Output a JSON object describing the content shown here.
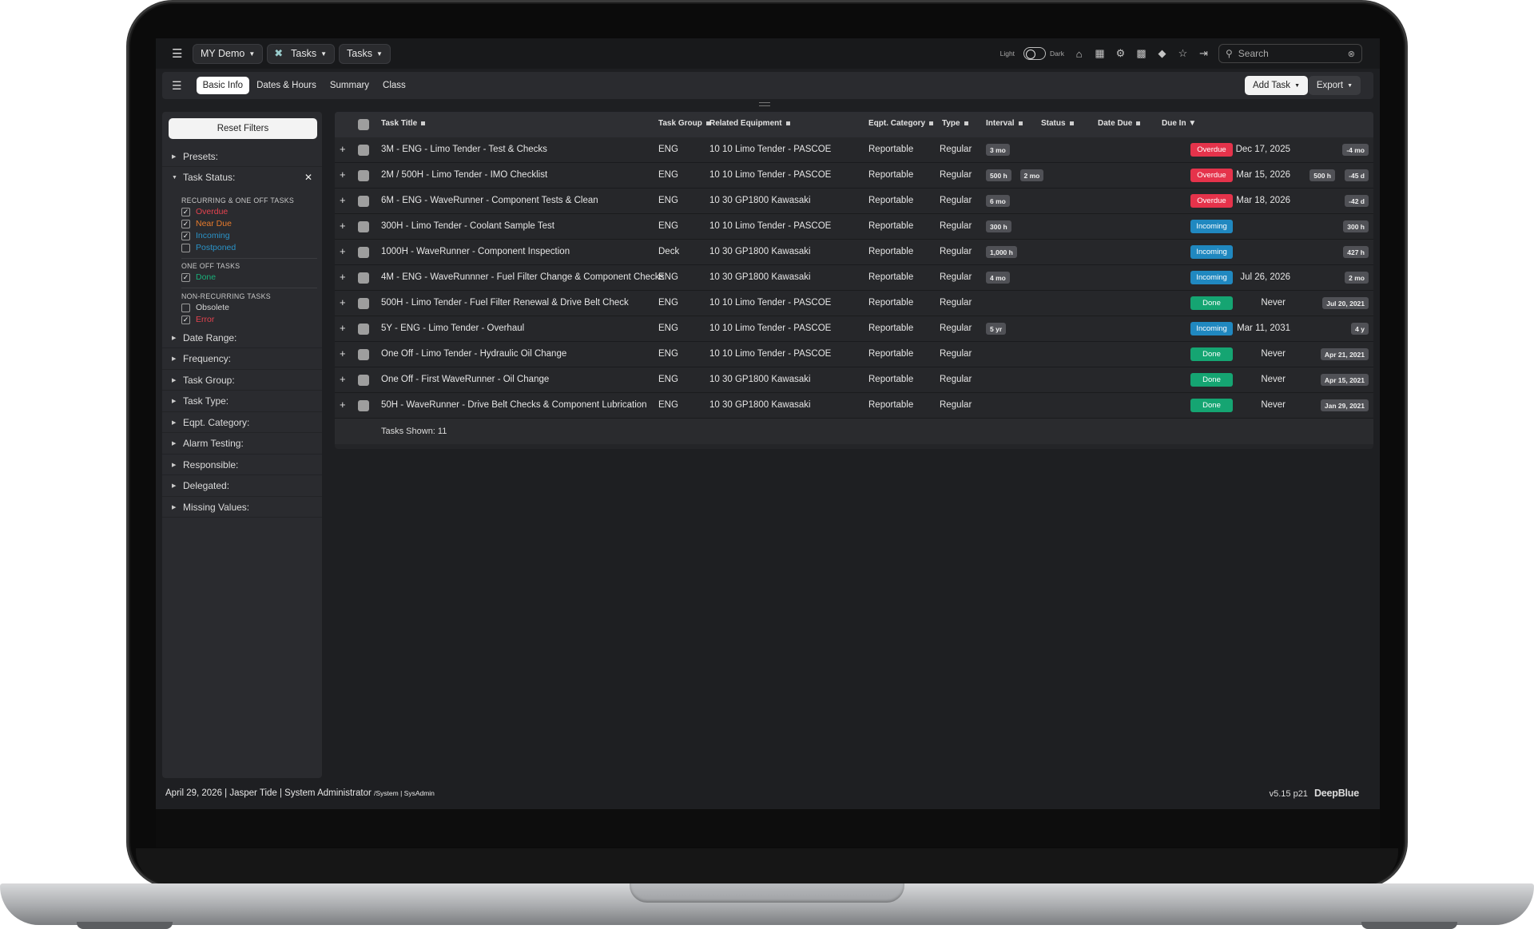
{
  "topbar": {
    "workspace": "MY Demo",
    "module": "Tasks",
    "view": "Tasks",
    "theme_light": "Light",
    "theme_dark": "Dark",
    "search_placeholder": "Search"
  },
  "navbar": {
    "tabs": [
      {
        "label": "Basic Info",
        "active": true
      },
      {
        "label": "Dates & Hours",
        "active": false
      },
      {
        "label": "Summary",
        "active": false
      },
      {
        "label": "Class",
        "active": false
      }
    ],
    "add_task": "Add Task",
    "export": "Export"
  },
  "sidebar": {
    "reset": "Reset Filters",
    "presets": "Presets:",
    "task_status": "Task Status:",
    "group1": "RECURRING & ONE OFF TASKS",
    "group1_items": [
      {
        "label": "Overdue",
        "checked": true,
        "color": "#e5434f"
      },
      {
        "label": "Near Due",
        "checked": true,
        "color": "#e87b2c"
      },
      {
        "label": "Incoming",
        "checked": true,
        "color": "#2a93c8"
      },
      {
        "label": "Postponed",
        "checked": false,
        "color": "#2a93c8"
      }
    ],
    "group2": "ONE OFF TASKS",
    "group2_items": [
      {
        "label": "Done",
        "checked": true,
        "color": "#19b07a"
      }
    ],
    "group3": "NON-RECURRING TASKS",
    "group3_items": [
      {
        "label": "Obsolete",
        "checked": false,
        "color": "#d4d4d4"
      },
      {
        "label": "Error",
        "checked": true,
        "color": "#e5434f"
      }
    ],
    "filters": [
      "Date Range:",
      "Frequency:",
      "Task Group:",
      "Task Type:",
      "Eqpt. Category:",
      "Alarm Testing:",
      "Responsible:",
      "Delegated:",
      "Missing Values:"
    ]
  },
  "table": {
    "headers": {
      "title": "Task Title",
      "group": "Task Group",
      "equipment": "Related Equipment",
      "category": "Eqpt. Category",
      "type": "Type",
      "interval": "Interval",
      "status": "Status",
      "date_due": "Date Due",
      "due_in": "Due In ▼"
    },
    "rows": [
      {
        "title": "3M - ENG - Limo Tender - Test & Checks",
        "group": "ENG",
        "equipment": "10 10 Limo Tender - PASCOE",
        "category": "Reportable",
        "type": "Regular",
        "interval": [
          "3 mo"
        ],
        "status": "Overdue",
        "date_due": "Dec 17, 2025",
        "due_in": [
          "-4 mo"
        ]
      },
      {
        "title": "2M / 500H - Limo Tender - IMO Checklist",
        "group": "ENG",
        "equipment": "10 10 Limo Tender - PASCOE",
        "category": "Reportable",
        "type": "Regular",
        "interval": [
          "500 h",
          "2 mo"
        ],
        "status": "Overdue",
        "date_due": "Mar 15, 2026",
        "due_in": [
          "500 h",
          "-45 d"
        ]
      },
      {
        "title": "6M - ENG - WaveRunner - Component Tests & Clean",
        "group": "ENG",
        "equipment": "10 30 GP1800 Kawasaki",
        "category": "Reportable",
        "type": "Regular",
        "interval": [
          "6 mo"
        ],
        "status": "Overdue",
        "date_due": "Mar 18, 2026",
        "due_in": [
          "-42 d"
        ]
      },
      {
        "title": "300H - Limo Tender - Coolant Sample Test",
        "group": "ENG",
        "equipment": "10 10 Limo Tender - PASCOE",
        "category": "Reportable",
        "type": "Regular",
        "interval": [
          "300 h"
        ],
        "status": "Incoming",
        "date_due": "",
        "due_in": [
          "300 h"
        ]
      },
      {
        "title": "1000H - WaveRunner - Component Inspection",
        "group": "Deck",
        "equipment": "10 30 GP1800 Kawasaki",
        "category": "Reportable",
        "type": "Regular",
        "interval": [
          "1,000 h"
        ],
        "status": "Incoming",
        "date_due": "",
        "due_in": [
          "427 h"
        ]
      },
      {
        "title": "4M - ENG - WaveRunnner - Fuel Filter Change & Component Checks",
        "group": "ENG",
        "equipment": "10 30 GP1800 Kawasaki",
        "category": "Reportable",
        "type": "Regular",
        "interval": [
          "4 mo"
        ],
        "status": "Incoming",
        "date_due": "Jul 26, 2026",
        "due_in": [
          "2 mo"
        ]
      },
      {
        "title": "500H - Limo Tender - Fuel Filter Renewal & Drive Belt Check",
        "group": "ENG",
        "equipment": "10 10 Limo Tender - PASCOE",
        "category": "Reportable",
        "type": "Regular",
        "interval": [],
        "status": "Done",
        "date_due": "Never",
        "due_in": [
          "Jul 20, 2021"
        ]
      },
      {
        "title": "5Y - ENG - Limo Tender - Overhaul",
        "group": "ENG",
        "equipment": "10 10 Limo Tender - PASCOE",
        "category": "Reportable",
        "type": "Regular",
        "interval": [
          "5 yr"
        ],
        "status": "Incoming",
        "date_due": "Mar 11, 2031",
        "due_in": [
          "4 y"
        ]
      },
      {
        "title": "One Off - Limo Tender - Hydraulic Oil Change",
        "group": "ENG",
        "equipment": "10 10 Limo Tender - PASCOE",
        "category": "Reportable",
        "type": "Regular",
        "interval": [],
        "status": "Done",
        "date_due": "Never",
        "due_in": [
          "Apr 21, 2021"
        ]
      },
      {
        "title": "One Off - First WaveRunner - Oil Change",
        "group": "ENG",
        "equipment": "10 30 GP1800 Kawasaki",
        "category": "Reportable",
        "type": "Regular",
        "interval": [],
        "status": "Done",
        "date_due": "Never",
        "due_in": [
          "Apr 15, 2021"
        ]
      },
      {
        "title": "50H - WaveRunner - Drive Belt Checks & Component Lubrication",
        "group": "ENG",
        "equipment": "10 30 GP1800 Kawasaki",
        "category": "Reportable",
        "type": "Regular",
        "interval": [],
        "status": "Done",
        "date_due": "Never",
        "due_in": [
          "Jan 29, 2021"
        ]
      }
    ],
    "footer": "Tasks Shown: 11"
  },
  "status": {
    "line": "April 29, 2026 | Jasper Tide | System Administrator",
    "path": "/System | SysAdmin",
    "version": "v5.15 p21",
    "brand": "DeepBlue"
  }
}
